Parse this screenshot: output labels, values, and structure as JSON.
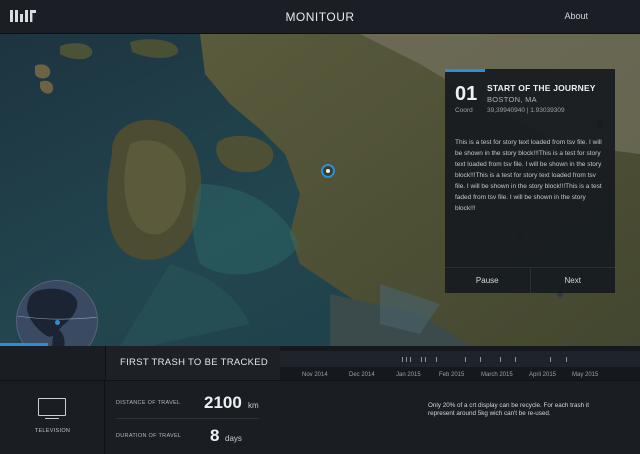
{
  "header": {
    "title": "MONITOUR",
    "about_label": "About",
    "logo_icon": "mit-logo-icon"
  },
  "story": {
    "number": "01",
    "title": "START OF THE JOURNEY",
    "subtitle": "BOSTON, MA",
    "coord_label": "Coord",
    "coord_value": "39,39940940 | 1.93039309",
    "text": "This is a test for story text loaded from tsv file. I will be shown in the story block!!!This is a test for story text loaded from tsv file. I will be shown in the story block!!!This is a test for story text loaded from tsv file. I will be shown in the story block!!!This is a test faded from tsv file. I will be shown in the story block!!!",
    "pause_label": "Pause",
    "next_label": "Next"
  },
  "section": {
    "title": "FIRST TRASH TO BE TRACKED"
  },
  "timeline": {
    "months": [
      "Nov 2014",
      "Dec 2014",
      "Jan 2015",
      "Feb 2015",
      "March 2015",
      "April 2015",
      "May 2015"
    ]
  },
  "item": {
    "icon": "television-icon",
    "label": "TELEVISION"
  },
  "stats": {
    "distance_label": "DISTANCE OF TRAVEL",
    "distance_value": "2100",
    "distance_unit": "km",
    "duration_label": "DURATION OF TRAVEL",
    "duration_value": "8",
    "duration_unit": "days"
  },
  "fact": {
    "text": "Only 20% of a crt display can be recycle. For each trash it represent around 5kg wich can't be re-used."
  },
  "colors": {
    "accent": "#2a8fd6",
    "background": "#14171c"
  }
}
